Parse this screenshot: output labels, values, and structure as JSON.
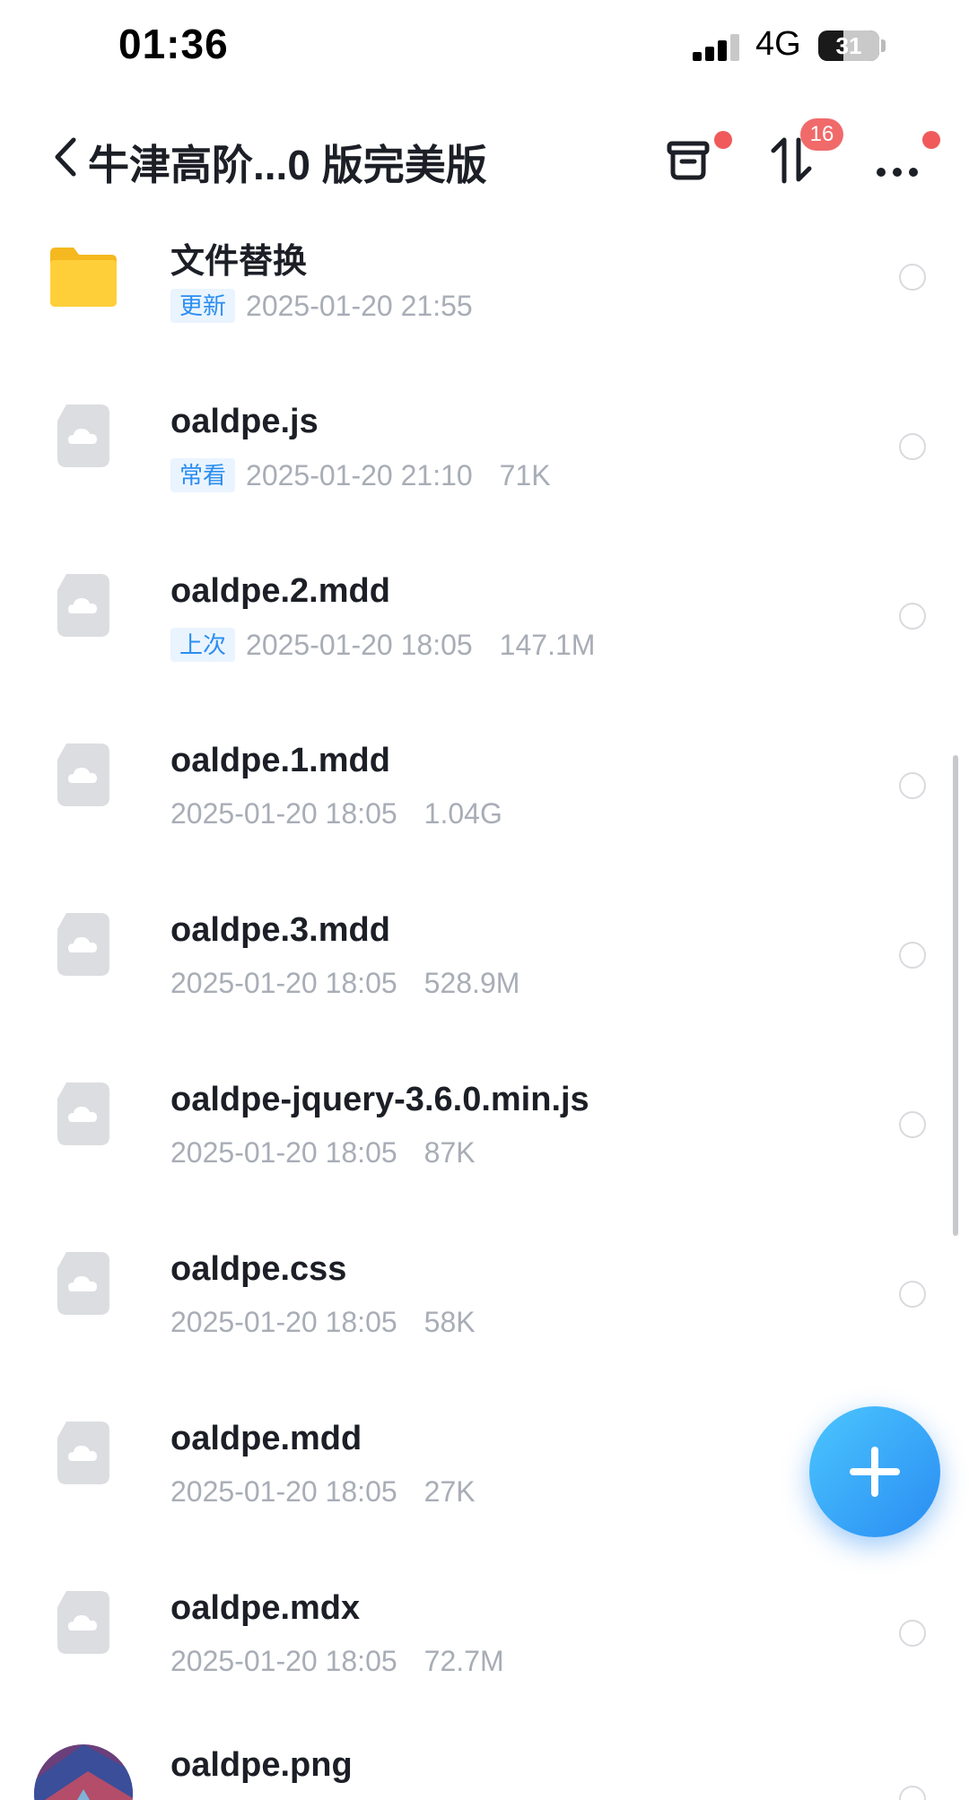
{
  "status_bar": {
    "time": "01:36",
    "network": "4G",
    "battery": "31"
  },
  "nav": {
    "title": "牛津高阶...0 版完美版",
    "transfer_badge": "16",
    "icons": [
      "chevron-left-icon",
      "inbox-icon",
      "transfer-icon",
      "more-icon"
    ]
  },
  "files": [
    {
      "name": "文件替换",
      "tag": "更新",
      "date": "2025-01-20 21:55",
      "size": "",
      "type": "folder"
    },
    {
      "name": "oaldpe.js",
      "tag": "常看",
      "date": "2025-01-20 21:10",
      "size": "71K",
      "type": "file"
    },
    {
      "name": "oaldpe.2.mdd",
      "tag": "上次",
      "date": "2025-01-20 18:05",
      "size": "147.1M",
      "type": "file"
    },
    {
      "name": "oaldpe.1.mdd",
      "tag": "",
      "date": "2025-01-20 18:05",
      "size": "1.04G",
      "type": "file"
    },
    {
      "name": "oaldpe.3.mdd",
      "tag": "",
      "date": "2025-01-20 18:05",
      "size": "528.9M",
      "type": "file"
    },
    {
      "name": "oaldpe-jquery-3.6.0.min.js",
      "tag": "",
      "date": "2025-01-20 18:05",
      "size": "87K",
      "type": "file"
    },
    {
      "name": "oaldpe.css",
      "tag": "",
      "date": "2025-01-20 18:05",
      "size": "58K",
      "type": "file"
    },
    {
      "name": "oaldpe.mdd",
      "tag": "",
      "date": "2025-01-20 18:05",
      "size": "27K",
      "type": "file"
    },
    {
      "name": "oaldpe.mdx",
      "tag": "",
      "date": "2025-01-20 18:05",
      "size": "72.7M",
      "type": "file"
    },
    {
      "name": "oaldpe.png",
      "tag": "",
      "date": "",
      "size": "",
      "type": "image"
    }
  ],
  "fab": {
    "icon": "plus-icon"
  },
  "colors": {
    "accent": "#2b8ef0",
    "badge": "#f06a6a",
    "folder": "#ffc62b"
  }
}
